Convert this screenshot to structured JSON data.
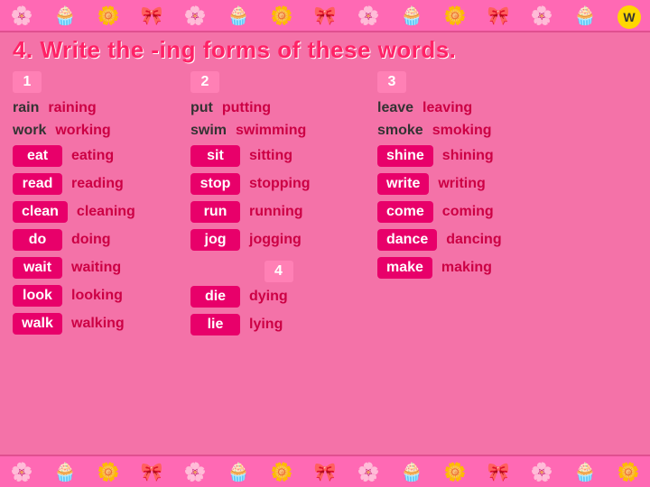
{
  "top_badge": "W",
  "title": "4. Write the -ing forms of these words.",
  "col_labels": [
    "1",
    "2",
    "3",
    "4"
  ],
  "col1": {
    "label": "1",
    "rows": [
      {
        "base": "rain",
        "ing": "raining",
        "highlighted": false
      },
      {
        "base": "work",
        "ing": "working",
        "highlighted": false
      },
      {
        "base": "eat",
        "ing": "eating",
        "highlighted": true
      },
      {
        "base": "read",
        "ing": "reading",
        "highlighted": true
      },
      {
        "base": "clean",
        "ing": "cleaning",
        "highlighted": true
      },
      {
        "base": "do",
        "ing": "doing",
        "highlighted": true
      },
      {
        "base": "wait",
        "ing": "waiting",
        "highlighted": true
      },
      {
        "base": "look",
        "ing": "looking",
        "highlighted": true
      },
      {
        "base": "walk",
        "ing": "walking",
        "highlighted": true
      }
    ]
  },
  "col2": {
    "label": "2",
    "rows": [
      {
        "base": "put",
        "ing": "putting",
        "highlighted": false
      },
      {
        "base": "swim",
        "ing": "swimming",
        "highlighted": false
      },
      {
        "base": "sit",
        "ing": "sitting",
        "highlighted": false
      },
      {
        "base": "stop",
        "ing": "stopping",
        "highlighted": false
      },
      {
        "base": "run",
        "ing": "running",
        "highlighted": false
      },
      {
        "base": "jog",
        "ing": "jogging",
        "highlighted": false
      }
    ],
    "sec4_label": "4",
    "sec4_rows": [
      {
        "base": "die",
        "ing": "dying"
      },
      {
        "base": "lie",
        "ing": "lying"
      }
    ]
  },
  "col3": {
    "label": "3",
    "rows": [
      {
        "base": "leave",
        "ing": "leaving",
        "highlighted": false
      },
      {
        "base": "smoke",
        "ing": "smoking",
        "highlighted": false
      },
      {
        "base": "shine",
        "ing": "shining",
        "highlighted": false
      },
      {
        "base": "write",
        "ing": "writing",
        "highlighted": false
      },
      {
        "base": "come",
        "ing": "coming",
        "highlighted": false
      },
      {
        "base": "dance",
        "ing": "dancing",
        "highlighted": false
      },
      {
        "base": "make",
        "ing": "making",
        "highlighted": false
      }
    ]
  },
  "decorative_icons": [
    "🌸",
    "🧁",
    "🌼",
    "🎀",
    "🌸",
    "🧁",
    "🌼",
    "🎀",
    "🌸",
    "🧁",
    "🌼",
    "🎀",
    "🌸",
    "🧁",
    "🌼"
  ]
}
